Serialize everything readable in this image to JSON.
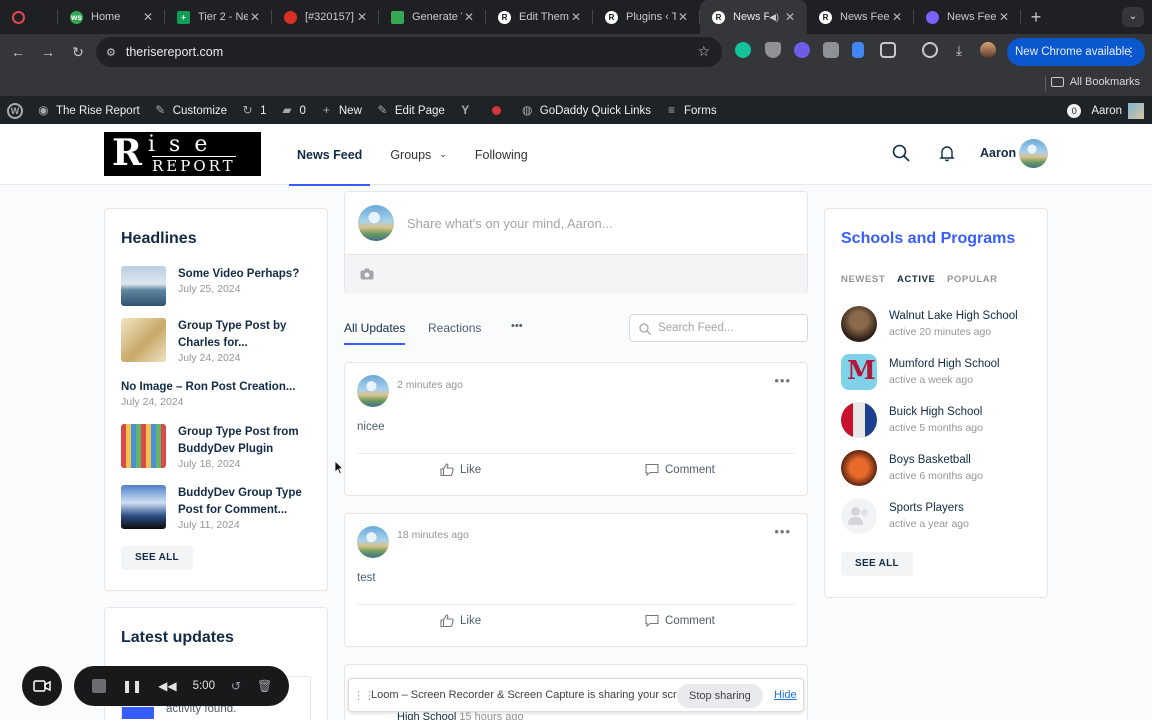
{
  "browser": {
    "tabs": [
      {
        "title": "",
        "icon": "record-icon",
        "color": "#e34850"
      },
      {
        "title": "Home",
        "icon": "ws-favicon",
        "color": "#34a853"
      },
      {
        "title": "Tier 2 - Ne",
        "icon": "sheets-favicon",
        "color": "#0f9d58"
      },
      {
        "title": "[#320157]",
        "icon": "ticket-favicon",
        "color": "#d93025"
      },
      {
        "title": "Generate V",
        "icon": "puzzle-favicon",
        "color": "#34a853"
      },
      {
        "title": "Edit Theme",
        "icon": "r-favicon",
        "color": "#ffffff"
      },
      {
        "title": "Plugins ‹ T",
        "icon": "r-favicon",
        "color": "#ffffff"
      },
      {
        "title": "News F",
        "icon": "r-favicon",
        "color": "#ffffff",
        "active": true
      },
      {
        "title": "News Feed",
        "icon": "r-favicon",
        "color": "#ffffff"
      },
      {
        "title": "News Feed",
        "icon": "gear-favicon",
        "color": "#7b61ff"
      }
    ],
    "url": "therisereport.com",
    "new_chrome_label": "New Chrome available",
    "all_bookmarks": "All Bookmarks"
  },
  "adminbar": {
    "site_name": "The Rise Report",
    "customize": "Customize",
    "updates_count": "1",
    "comments_count": "0",
    "new": "New",
    "edit_page": "Edit Page",
    "quick_links": "GoDaddy Quick Links",
    "forms": "Forms",
    "notifications_count": "0",
    "user": "Aaron"
  },
  "header": {
    "logo_r": "R",
    "logo_ise": "ise",
    "logo_report": "REPORT",
    "nav": [
      "News Feed",
      "Groups",
      "Following"
    ],
    "user_name": "Aaron"
  },
  "headlines": {
    "title": "Headlines",
    "items": [
      {
        "title": "Some Video Perhaps?",
        "date": "July 25, 2024"
      },
      {
        "title": "Group Type Post by Charles for...",
        "date": "July 24, 2024"
      },
      {
        "title": "No Image – Ron Post Creation...",
        "date": "July 24, 2024"
      },
      {
        "title": "Group Type Post from BuddyDev Plugin",
        "date": "July 18, 2024"
      },
      {
        "title": "BuddyDev Group Type Post for Comment...",
        "date": "July 11, 2024"
      }
    ],
    "see_all": "SEE ALL"
  },
  "latest_updates": {
    "title": "Latest updates",
    "snippet": "activity found."
  },
  "composer": {
    "placeholder": "Share what's on your mind, Aaron..."
  },
  "feed": {
    "tabs": [
      "All Updates",
      "Reactions"
    ],
    "more": "•••",
    "search_placeholder": "Search Feed...",
    "posts": [
      {
        "time": "2 minutes ago",
        "text": "nicee"
      },
      {
        "time": "18 minutes ago",
        "text": "test"
      }
    ],
    "like_label": "Like",
    "comment_label": "Comment",
    "partial_post": {
      "group": "High School",
      "time": "15 hours ago"
    }
  },
  "schools": {
    "title": "Schools and Programs",
    "filters": [
      "NEWEST",
      "ACTIVE",
      "POPULAR"
    ],
    "items": [
      {
        "name": "Walnut Lake High School",
        "active": "active 20 minutes ago"
      },
      {
        "name": "Mumford High School",
        "active": "active a week ago"
      },
      {
        "name": "Buick High School",
        "active": "active 5 months ago"
      },
      {
        "name": "Boys Basketball",
        "active": "active 6 months ago"
      },
      {
        "name": "Sports Players",
        "active": "active a year ago"
      }
    ],
    "see_all": "SEE ALL"
  },
  "loom": {
    "timer": "5:00",
    "share_message": "Loom – Screen Recorder & Screen Capture is sharing your screen.",
    "stop_sharing": "Stop sharing",
    "hide": "Hide"
  }
}
